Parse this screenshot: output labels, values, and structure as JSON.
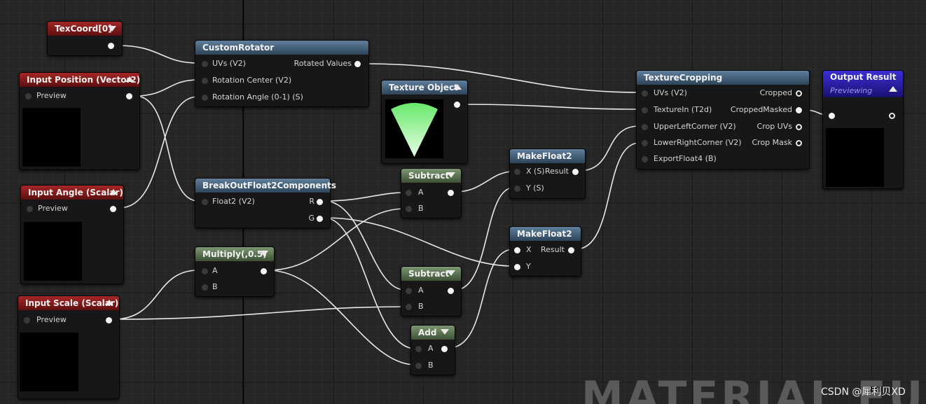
{
  "nodes": {
    "texcoord": {
      "title": "TexCoord[0]"
    },
    "custom_rotator": {
      "title": "CustomRotator",
      "in1": "UVs (V2)",
      "in2": "Rotation Center (V2)",
      "in3": "Rotation Angle (0-1) (S)",
      "out1": "Rotated Values"
    },
    "input_position": {
      "title": "Input Position (Vector2)",
      "preview": "Preview"
    },
    "input_angle": {
      "title": "Input Angle (Scalar)",
      "preview": "Preview"
    },
    "input_scale": {
      "title": "Input Scale (Scalar)",
      "preview": "Preview"
    },
    "texture_object": {
      "title": "Texture Object"
    },
    "break_out": {
      "title": "BreakOutFloat2Components",
      "in1": "Float2 (V2)",
      "out1": "R",
      "out2": "G"
    },
    "multiply": {
      "title": "Multiply(,0.5)",
      "in1": "A",
      "in2": "B"
    },
    "subtract1": {
      "title": "Subtract",
      "in1": "A",
      "in2": "B"
    },
    "subtract2": {
      "title": "Subtract",
      "in1": "A",
      "in2": "B"
    },
    "add": {
      "title": "Add",
      "in1": "A",
      "in2": "B"
    },
    "makefloat2_1": {
      "title": "MakeFloat2",
      "in1": "X (S)",
      "in2": "Y (S)",
      "out1": "Result"
    },
    "makefloat2_2": {
      "title": "MakeFloat2",
      "in1": "X",
      "in2": "Y",
      "out1": "Result"
    },
    "texture_cropping": {
      "title": "TextureCropping",
      "inputs": [
        "UVs (V2)",
        "TextureIn (T2d)",
        "UpperLeftCorner (V2)",
        "LowerRightCorner (V2)",
        "ExportFloat4 (B)"
      ],
      "outputs": [
        "Cropped",
        "CroppedMasked",
        "Crop UVs",
        "Crop Mask"
      ]
    },
    "output_result": {
      "title": "Output Result",
      "subtitle": "Previewing"
    }
  },
  "watermark": "MATERIAL FUNCTIO",
  "credit": "CSDN @犀利贝XD"
}
